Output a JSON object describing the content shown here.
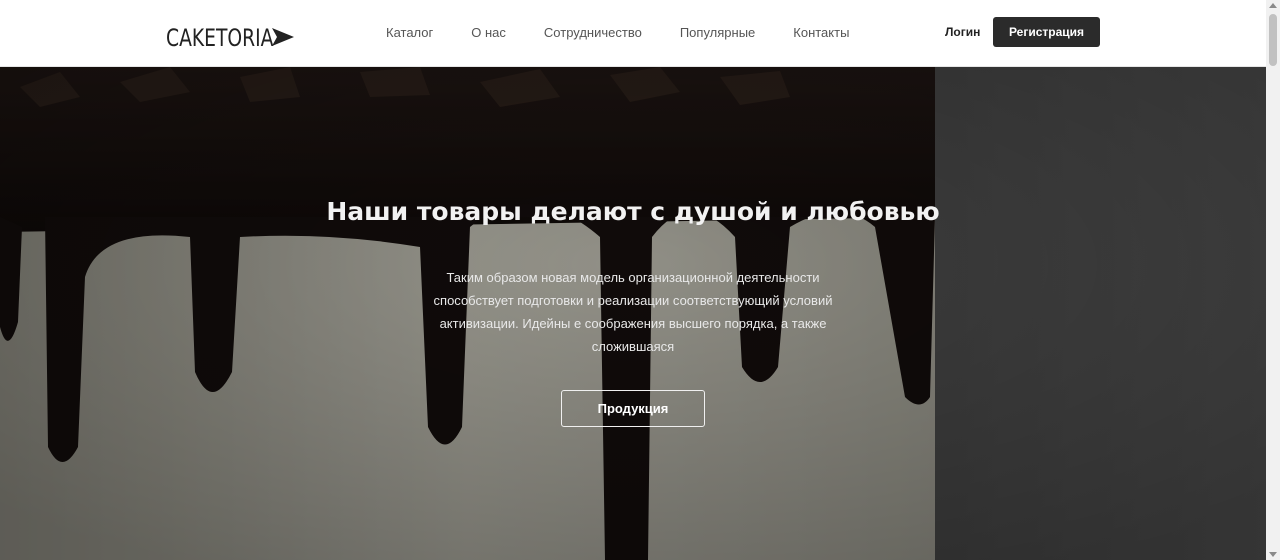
{
  "header": {
    "logo_text": "CAKETORIA",
    "nav": [
      "Каталог",
      "О нас",
      "Сотрудничество",
      "Популярные",
      "Контакты"
    ],
    "login_label": "Логин",
    "register_label": "Регистрация"
  },
  "hero": {
    "title": "Наши товары делают с душой и любовью",
    "text": "Таким образом новая модель организационной деятельности способствует подготовки и реализации соответствующий условий активизации. Идейны е соображения высшего порядка, а также сложившаяся",
    "button_label": "Продукция"
  },
  "colors": {
    "accent_dark": "#2b2b2b",
    "chocolate": "#1a1210",
    "cream": "#d9d8c9"
  },
  "icons": [
    "play-triangle-icon"
  ]
}
